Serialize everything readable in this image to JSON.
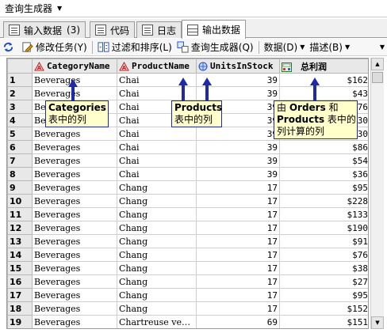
{
  "window": {
    "title": "查询生成器"
  },
  "tabs": [
    {
      "label": "输入数据",
      "count": "(3)"
    },
    {
      "label": "代码"
    },
    {
      "label": "日志"
    },
    {
      "label": "输出数据"
    }
  ],
  "toolbar": {
    "modify_task": "修改任务(Y)",
    "filter_sort": "过滤和排序(L)",
    "query_builder": "查询生成器(Q)",
    "data_menu": "数据(D)",
    "describe_menu": "描述(B)"
  },
  "table": {
    "columns": [
      "CategoryName",
      "ProductName",
      "UnitsInStock",
      "总利润"
    ],
    "rows": [
      {
        "n": "1",
        "category": "Beverages",
        "product": "Chai",
        "units": "39",
        "profit": "$162"
      },
      {
        "n": "2",
        "category": "Beverages",
        "product": "Chai",
        "units": "39",
        "profit": "$43"
      },
      {
        "n": "3",
        "category": "Beverages",
        "product": "Chai",
        "units": "39",
        "profit": "$76"
      },
      {
        "n": "4",
        "category": "Beverages",
        "product": "Chai",
        "units": "39",
        "profit": "$130"
      },
      {
        "n": "5",
        "category": "Beverages",
        "product": "Chai",
        "units": "39",
        "profit": "$130"
      },
      {
        "n": "6",
        "category": "Beverages",
        "product": "Chai",
        "units": "39",
        "profit": "$86"
      },
      {
        "n": "7",
        "category": "Beverages",
        "product": "Chai",
        "units": "39",
        "profit": "$54"
      },
      {
        "n": "8",
        "category": "Beverages",
        "product": "Chai",
        "units": "39",
        "profit": "$36"
      },
      {
        "n": "9",
        "category": "Beverages",
        "product": "Chang",
        "units": "17",
        "profit": "$95"
      },
      {
        "n": "10",
        "category": "Beverages",
        "product": "Chang",
        "units": "17",
        "profit": "$228"
      },
      {
        "n": "11",
        "category": "Beverages",
        "product": "Chang",
        "units": "17",
        "profit": "$133"
      },
      {
        "n": "12",
        "category": "Beverages",
        "product": "Chang",
        "units": "17",
        "profit": "$190"
      },
      {
        "n": "13",
        "category": "Beverages",
        "product": "Chang",
        "units": "17",
        "profit": "$91"
      },
      {
        "n": "14",
        "category": "Beverages",
        "product": "Chang",
        "units": "17",
        "profit": "$76"
      },
      {
        "n": "15",
        "category": "Beverages",
        "product": "Chang",
        "units": "17",
        "profit": "$38"
      },
      {
        "n": "16",
        "category": "Beverages",
        "product": "Chang",
        "units": "17",
        "profit": "$27"
      },
      {
        "n": "17",
        "category": "Beverages",
        "product": "Chang",
        "units": "17",
        "profit": "$95"
      },
      {
        "n": "18",
        "category": "Beverages",
        "product": "Chang",
        "units": "17",
        "profit": "$152"
      },
      {
        "n": "19",
        "category": "Beverages",
        "product": "Chartreuse ve…",
        "units": "69",
        "profit": "$151"
      }
    ]
  },
  "callouts": {
    "categories": {
      "bold": "Categories",
      "text": "表中的列"
    },
    "products": {
      "bold": "Products",
      "text": "表中的列"
    },
    "profit": {
      "line1_pre": "由 ",
      "line1_bold": "Orders",
      "line1_post": " 和",
      "line2_bold": "Products",
      "line2_post": " 表中的",
      "line3": "列计算的列"
    }
  },
  "icons": {
    "char_column": "warning-triangle-icon",
    "numeric_column": "globe-icon",
    "computed_column": "calculator-icon"
  },
  "colors": {
    "callout_bg": "#ffffcc",
    "callout_border": "#1f2aa8",
    "arrow": "#1f2aa8"
  }
}
